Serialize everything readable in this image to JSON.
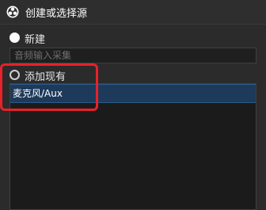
{
  "window": {
    "title": "创建或选择源",
    "icon": "obs-logo-icon"
  },
  "options": {
    "create_new": {
      "label": "新建",
      "selected": true
    },
    "add_existing": {
      "label": "添加现有",
      "selected": false
    }
  },
  "name_field": {
    "placeholder": "音频输入采集"
  },
  "existing_sources": [
    "麦克风/Aux"
  ],
  "colors": {
    "highlight": "#e8212a",
    "selection": "#1e3a5a"
  }
}
